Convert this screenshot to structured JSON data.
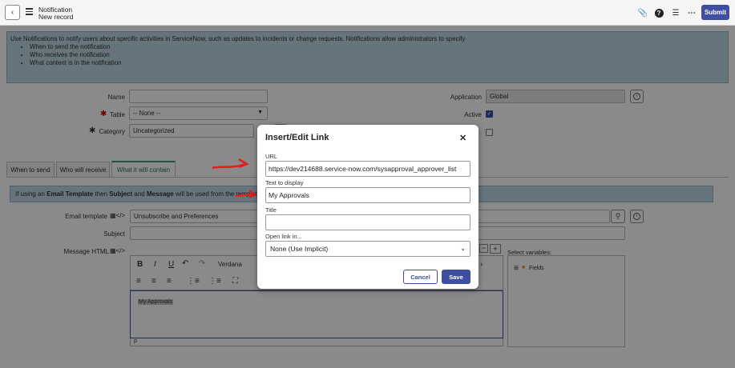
{
  "header": {
    "title": "Notification",
    "subtitle": "New record",
    "submit_label": "Submit"
  },
  "info_banner": {
    "text": "Use Notifications to notify users about specific activities in ServiceNow, such as updates to incidents or change requests. Notifications allow administrators to specify",
    "bullets": [
      "When to send the notification",
      "Who receives the notification",
      "What content is in the notification"
    ]
  },
  "form": {
    "name_label": "Name",
    "name_value": "",
    "table_label": "Table",
    "table_value": "-- None --",
    "category_label": "Category",
    "category_value": "Uncategorized",
    "application_label": "Application",
    "application_value": "Global",
    "active_label": "Active",
    "active_checked": true
  },
  "tabs": [
    {
      "label": "When to send"
    },
    {
      "label": "Who will receive"
    },
    {
      "label": "What it will contain"
    }
  ],
  "template_hint": {
    "prefix": "If using an ",
    "bold1": "Email Template",
    "mid1": " then ",
    "bold2": "Subject",
    "mid2": " and ",
    "bold3": "Message",
    "suffix": " will be used from the templat"
  },
  "content": {
    "email_template_label": "Email template",
    "email_template_value": "Unsubscribe and Preferences",
    "subject_label": "Subject",
    "subject_value": "",
    "message_label": "Message HTML",
    "font_name": "Verdana",
    "editor_text": "My Approvals",
    "editor_status": "p",
    "select_variables_label": "Select variables:",
    "tree_item": "Fields"
  },
  "dialog": {
    "title": "Insert/Edit Link",
    "url_label": "URL",
    "url_value": "https://dev214688.service-now.com/sysapproval_approver_list",
    "text_label": "Text to display",
    "text_value": "My Approvals",
    "title_label": "Title",
    "title_value": "",
    "open_label": "Open link in...",
    "open_value": "None (Use Implicit)",
    "cancel_label": "Cancel",
    "save_label": "Save"
  },
  "colors": {
    "accent": "#3f4ea0",
    "info_bg": "#bcd8e6",
    "arrow_red": "#e0201b",
    "tab_active": "#3f9a7f"
  }
}
